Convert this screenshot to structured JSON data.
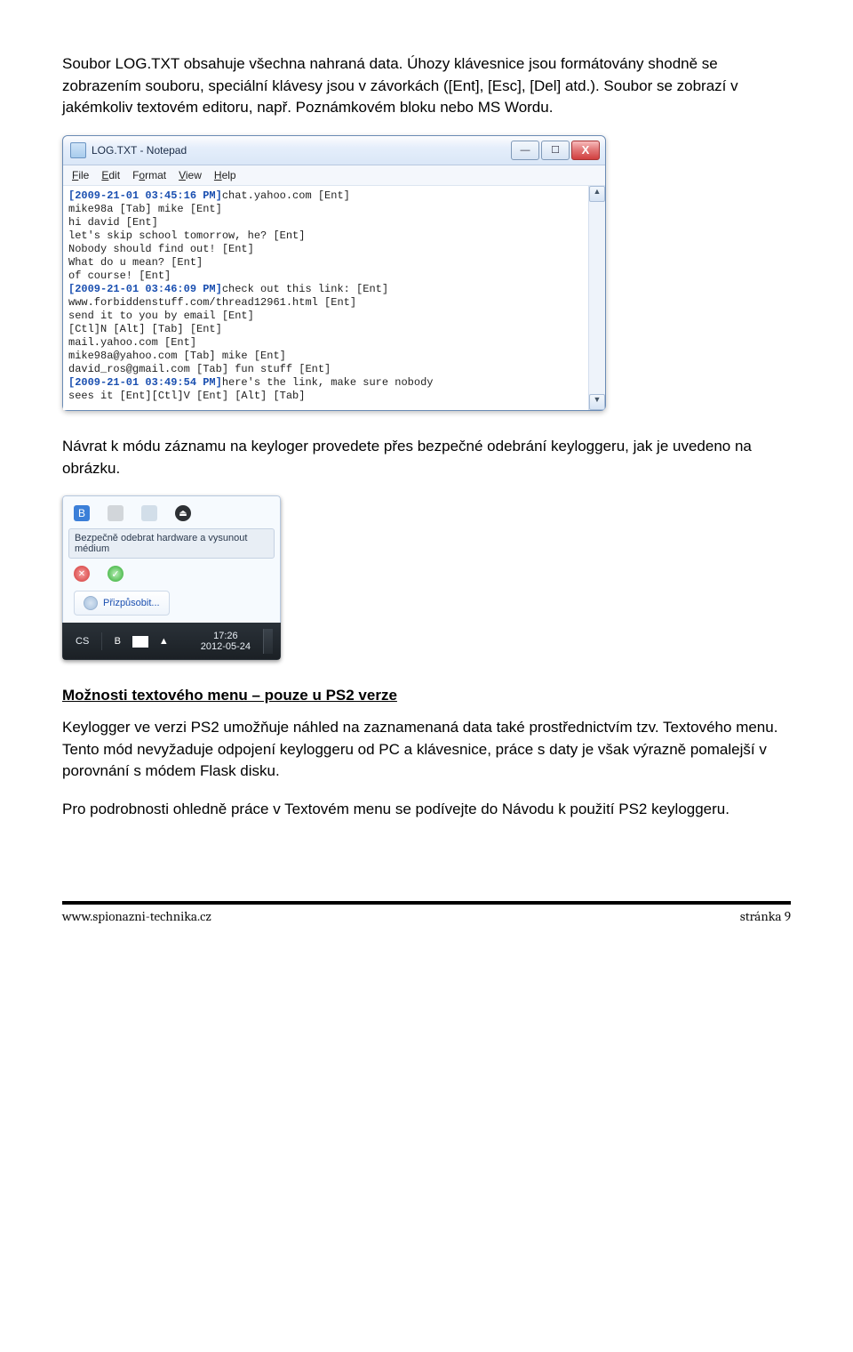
{
  "body": {
    "p1": "Soubor LOG.TXT obsahuje všechna nahraná data. Úhozy klávesnice jsou formátovány shodně se zobrazením souboru, speciální klávesy jsou v závorkách ([Ent], [Esc], [Del] atd.). Soubor se zobrazí v jakémkoliv textovém editoru, např. Poznámkovém bloku nebo MS Wordu.",
    "p2": "Návrat k módu záznamu na keyloger provedete přes bezpečné odebrání keyloggeru, jak je uvedeno na obrázku.",
    "section_title": "Možnosti textového menu – pouze u PS2 verze",
    "p3": "Keylogger ve verzi PS2 umožňuje náhled na zaznamenaná data také prostřednictvím tzv. Textového menu. Tento mód nevyžaduje odpojení keyloggeru od PC a klávesnice, práce s daty je však výrazně pomalejší v porovnání s módem Flask disku.",
    "p4": "Pro podrobnosti ohledně práce v Textovém menu se podívejte do Návodu k použití PS2 keyloggeru."
  },
  "notepad": {
    "title": "LOG.TXT - Notepad",
    "menu": {
      "file": "File",
      "edit": "Edit",
      "format": "Format",
      "view": "View",
      "help": "Help"
    },
    "win": {
      "min": "—",
      "max": "☐",
      "close": "X"
    },
    "scroll": {
      "up": "▲",
      "down": "▼"
    },
    "lines": {
      "l1_ts": "[2009-21-01 03:45:16 PM]",
      "l1_rest": "chat.yahoo.com [Ent]",
      "l2": "mike98a [Tab] mike [Ent]",
      "l3": "hi david [Ent]",
      "l4": "let's skip school tomorrow, he? [Ent]",
      "l5": "Nobody should find out! [Ent]",
      "l6": "What do u mean? [Ent]",
      "l7": "of course! [Ent]",
      "l8_ts": "[2009-21-01 03:46:09 PM]",
      "l8_rest": "check out this link: [Ent]",
      "l9": "www.forbiddenstuff.com/thread12961.html [Ent]",
      "l10": "send it to you by email [Ent]",
      "l11": "[Ctl]N [Alt] [Tab] [Ent]",
      "l12": "mail.yahoo.com [Ent]",
      "l13": "mike98a@yahoo.com [Tab] mike [Ent]",
      "l14": "david_ros@gmail.com [Tab] fun stuff [Ent]",
      "l15_ts": "[2009-21-01 03:49:54 PM]",
      "l15_rest": "here's the link, make sure nobody",
      "l16": "sees it [Ent][Ctl]V [Ent] [Alt] [Tab]"
    }
  },
  "tray": {
    "bt": "B",
    "usb": "⏏",
    "tooltip": "Bezpečně odebrat hardware a vysunout médium",
    "x": "✕",
    "chk": "✓",
    "customize": "Přizpůsobit...",
    "lang": "CS",
    "bt2": "B",
    "net_up": "▲",
    "clock_time": "17:26",
    "clock_date": "2012-05-24"
  },
  "footer": {
    "left": "www.spionazni-technika.cz",
    "right": "stránka 9"
  }
}
